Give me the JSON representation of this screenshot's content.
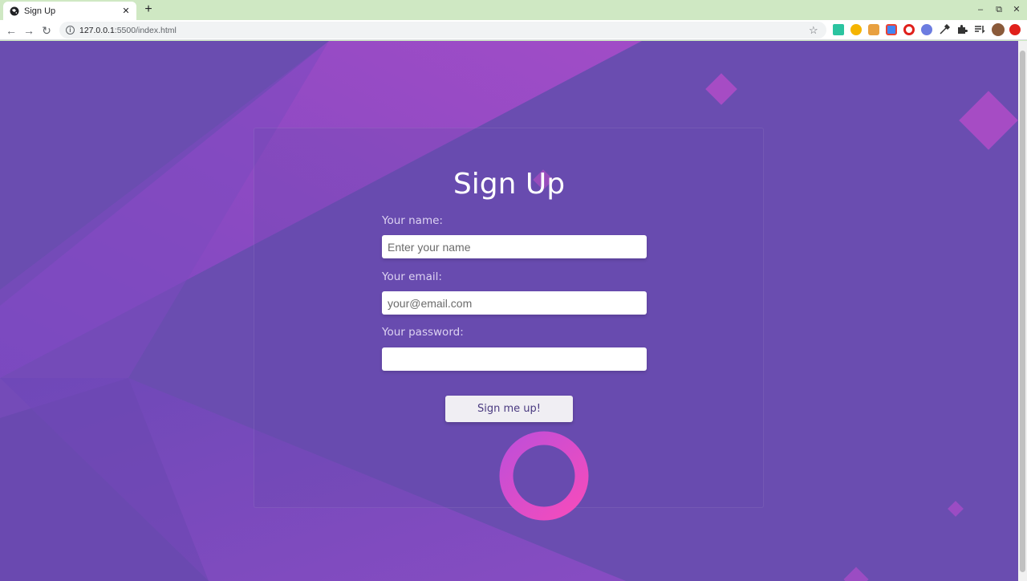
{
  "browser": {
    "tab_title": "Sign Up",
    "tab_close_glyph": "✕",
    "new_tab_glyph": "+",
    "url_host": "127.0.0.1",
    "url_path": ":5500/index.html",
    "window_controls": [
      "–",
      "⧉",
      "✕"
    ],
    "nav": {
      "back": "←",
      "forward": "→",
      "reload": "↻"
    },
    "extensions": [
      "puzzle-piece-icon",
      "profile-avatar"
    ]
  },
  "page": {
    "title": "Sign Up",
    "fields": [
      {
        "label": "Your name:",
        "placeholder": "Enter your name",
        "type": "text"
      },
      {
        "label": "Your email:",
        "placeholder": "your@email.com",
        "type": "email"
      },
      {
        "label": "Your password:",
        "placeholder": "",
        "type": "password"
      }
    ],
    "submit_label": "Sign me up!"
  },
  "colors": {
    "background": "#6a4db0",
    "accent_pink": "#e84cc0",
    "shape_purple": "#9a4ccc",
    "button_text": "#4a3a80"
  }
}
